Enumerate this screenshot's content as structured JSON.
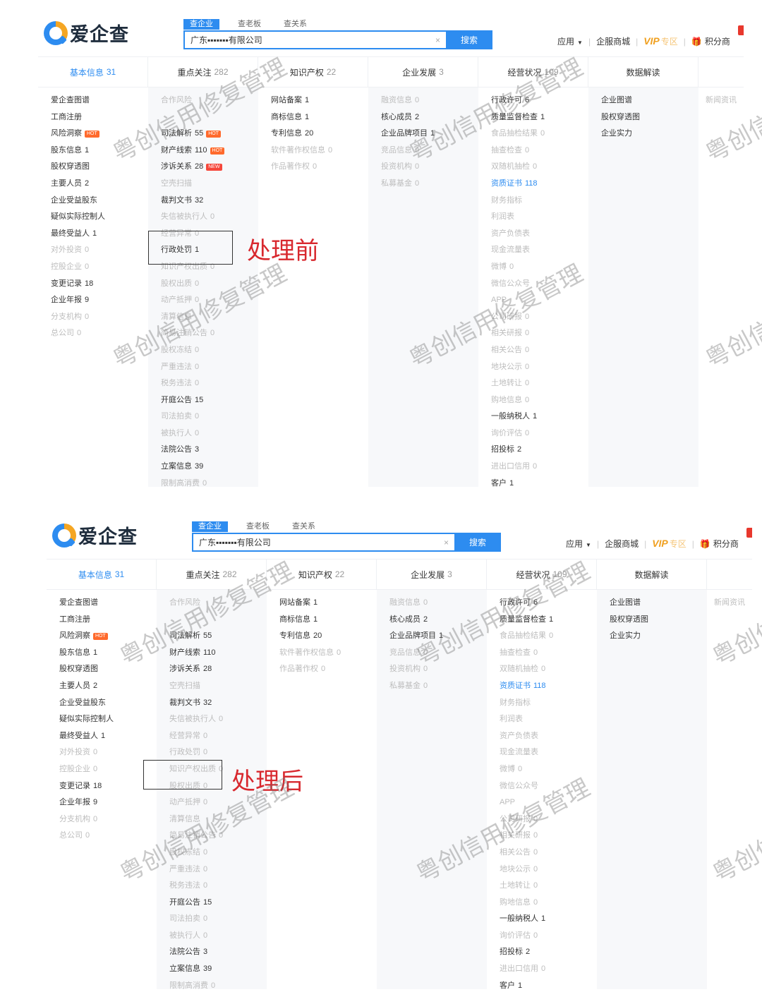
{
  "app": {
    "logo_text": "爱企查",
    "search_tabs": [
      "查企业",
      "查老板",
      "查关系"
    ],
    "search_value": "广东▪▪▪▪▪▪▪有限公司",
    "search_button": "搜索",
    "clear_symbol": "×",
    "header_right": {
      "apps": "应用",
      "mall": "企服商城",
      "vip": "VIP",
      "vip_sub": "专区",
      "points": "积分商"
    }
  },
  "categories": [
    {
      "label": "基本信息",
      "count": "31"
    },
    {
      "label": "重点关注",
      "count": "282"
    },
    {
      "label": "知识产权",
      "count": "22"
    },
    {
      "label": "企业发展",
      "count": "3"
    },
    {
      "label": "经营状况",
      "count": "109"
    },
    {
      "label": "数据解读",
      "count": ""
    },
    {
      "label": "",
      "count": ""
    }
  ],
  "columns": [
    [
      {
        "label": "爱企查图谱",
        "count": "",
        "style": "normal"
      },
      {
        "label": "工商注册",
        "count": "",
        "style": "normal"
      },
      {
        "label": "风险洞察",
        "count": "",
        "style": "normal",
        "tag": "HOT"
      },
      {
        "label": "股东信息",
        "count": "1",
        "style": "normal"
      },
      {
        "label": "股权穿透图",
        "count": "",
        "style": "normal"
      },
      {
        "label": "主要人员",
        "count": "2",
        "style": "normal"
      },
      {
        "label": "企业受益股东",
        "count": "",
        "style": "normal"
      },
      {
        "label": "疑似实际控制人",
        "count": "",
        "style": "normal"
      },
      {
        "label": "最终受益人",
        "count": "1",
        "style": "normal"
      },
      {
        "label": "对外投资",
        "count": "0",
        "style": "muted"
      },
      {
        "label": "控股企业",
        "count": "0",
        "style": "muted"
      },
      {
        "label": "变更记录",
        "count": "18",
        "style": "normal"
      },
      {
        "label": "企业年报",
        "count": "9",
        "style": "normal"
      },
      {
        "label": "分支机构",
        "count": "0",
        "style": "muted"
      },
      {
        "label": "总公司",
        "count": "0",
        "style": "muted"
      }
    ],
    [
      {
        "label": "合作风险",
        "count": "",
        "style": "muted"
      },
      {
        "label": "",
        "count": "",
        "style": "muted"
      },
      {
        "label": "司法解析",
        "count": "55",
        "style": "normal",
        "tag": "HOT"
      },
      {
        "label": "财产线索",
        "count": "110",
        "style": "normal",
        "tag": "HOT"
      },
      {
        "label": "涉诉关系",
        "count": "28",
        "style": "normal",
        "tag": "NEW"
      },
      {
        "label": "空壳扫描",
        "count": "",
        "style": "muted"
      },
      {
        "label": "裁判文书",
        "count": "32",
        "style": "normal"
      },
      {
        "label": "失信被执行人",
        "count": "0",
        "style": "muted"
      },
      {
        "label": "经营异常",
        "count": "0",
        "style": "muted"
      },
      {
        "label": "行政处罚",
        "count": "1",
        "style": "normal"
      },
      {
        "label": "知识产权出质",
        "count": "0",
        "style": "muted"
      },
      {
        "label": "股权出质",
        "count": "0",
        "style": "muted"
      },
      {
        "label": "动产抵押",
        "count": "0",
        "style": "muted"
      },
      {
        "label": "清算信息",
        "count": "",
        "style": "muted"
      },
      {
        "label": "简易注销公告",
        "count": "0",
        "style": "muted"
      },
      {
        "label": "股权冻结",
        "count": "0",
        "style": "muted"
      },
      {
        "label": "严重违法",
        "count": "0",
        "style": "muted"
      },
      {
        "label": "税务违法",
        "count": "0",
        "style": "muted"
      },
      {
        "label": "开庭公告",
        "count": "15",
        "style": "normal"
      },
      {
        "label": "司法拍卖",
        "count": "0",
        "style": "muted"
      },
      {
        "label": "被执行人",
        "count": "0",
        "style": "muted"
      },
      {
        "label": "法院公告",
        "count": "3",
        "style": "normal"
      },
      {
        "label": "立案信息",
        "count": "39",
        "style": "normal"
      },
      {
        "label": "限制高消费",
        "count": "0",
        "style": "muted"
      }
    ],
    [
      {
        "label": "网站备案",
        "count": "1",
        "style": "normal"
      },
      {
        "label": "商标信息",
        "count": "1",
        "style": "normal"
      },
      {
        "label": "专利信息",
        "count": "20",
        "style": "normal"
      },
      {
        "label": "软件著作权信息",
        "count": "0",
        "style": "muted"
      },
      {
        "label": "作品著作权",
        "count": "0",
        "style": "muted"
      }
    ],
    [
      {
        "label": "融资信息",
        "count": "0",
        "style": "muted"
      },
      {
        "label": "核心成员",
        "count": "2",
        "style": "normal"
      },
      {
        "label": "企业品牌项目",
        "count": "1",
        "style": "normal"
      },
      {
        "label": "竞品信息",
        "count": "0",
        "style": "muted"
      },
      {
        "label": "投资机构",
        "count": "0",
        "style": "muted"
      },
      {
        "label": "私募基金",
        "count": "0",
        "style": "muted"
      }
    ],
    [
      {
        "label": "行政许可",
        "count": "6",
        "style": "normal"
      },
      {
        "label": "质量监督检查",
        "count": "1",
        "style": "normal"
      },
      {
        "label": "食品抽检结果",
        "count": "0",
        "style": "muted"
      },
      {
        "label": "抽查检查",
        "count": "0",
        "style": "muted"
      },
      {
        "label": "双随机抽检",
        "count": "0",
        "style": "muted"
      },
      {
        "label": "资质证书",
        "count": "118",
        "style": "blue"
      },
      {
        "label": "财务指标",
        "count": "",
        "style": "muted"
      },
      {
        "label": "利润表",
        "count": "",
        "style": "muted"
      },
      {
        "label": "资产负债表",
        "count": "",
        "style": "muted"
      },
      {
        "label": "现金流量表",
        "count": "",
        "style": "muted"
      },
      {
        "label": "微博",
        "count": "0",
        "style": "muted"
      },
      {
        "label": "微信公众号",
        "count": "",
        "style": "muted"
      },
      {
        "label": "APP",
        "count": "",
        "style": "muted"
      },
      {
        "label": "公司研报",
        "count": "0",
        "style": "muted"
      },
      {
        "label": "相关研报",
        "count": "0",
        "style": "muted"
      },
      {
        "label": "相关公告",
        "count": "0",
        "style": "muted"
      },
      {
        "label": "地块公示",
        "count": "0",
        "style": "muted"
      },
      {
        "label": "土地转让",
        "count": "0",
        "style": "muted"
      },
      {
        "label": "购地信息",
        "count": "0",
        "style": "muted"
      },
      {
        "label": "一般纳税人",
        "count": "1",
        "style": "normal"
      },
      {
        "label": "询价评估",
        "count": "0",
        "style": "muted"
      },
      {
        "label": "招投标",
        "count": "2",
        "style": "normal"
      },
      {
        "label": "进出口信用",
        "count": "0",
        "style": "muted"
      },
      {
        "label": "客户",
        "count": "1",
        "style": "normal"
      }
    ],
    [
      {
        "label": "企业图谱",
        "count": "",
        "style": "normal"
      },
      {
        "label": "股权穿透图",
        "count": "",
        "style": "normal"
      },
      {
        "label": "企业实力",
        "count": "",
        "style": "normal"
      }
    ],
    [
      {
        "label": "新闻资讯",
        "count": "",
        "style": "muted"
      }
    ]
  ],
  "after_overrides": {
    "risk_tag_only": true,
    "penalty_label": "行政处罚",
    "penalty_count": "0",
    "penalty_style": "muted"
  },
  "annotations": {
    "before": "处理前",
    "after": "处理后"
  },
  "watermark_text": "粤创信用修复管理",
  "colors": {
    "brand_blue": "#2d8cf0",
    "annotation_red": "#d8282e",
    "hot_tag": "#ff6a2c"
  }
}
